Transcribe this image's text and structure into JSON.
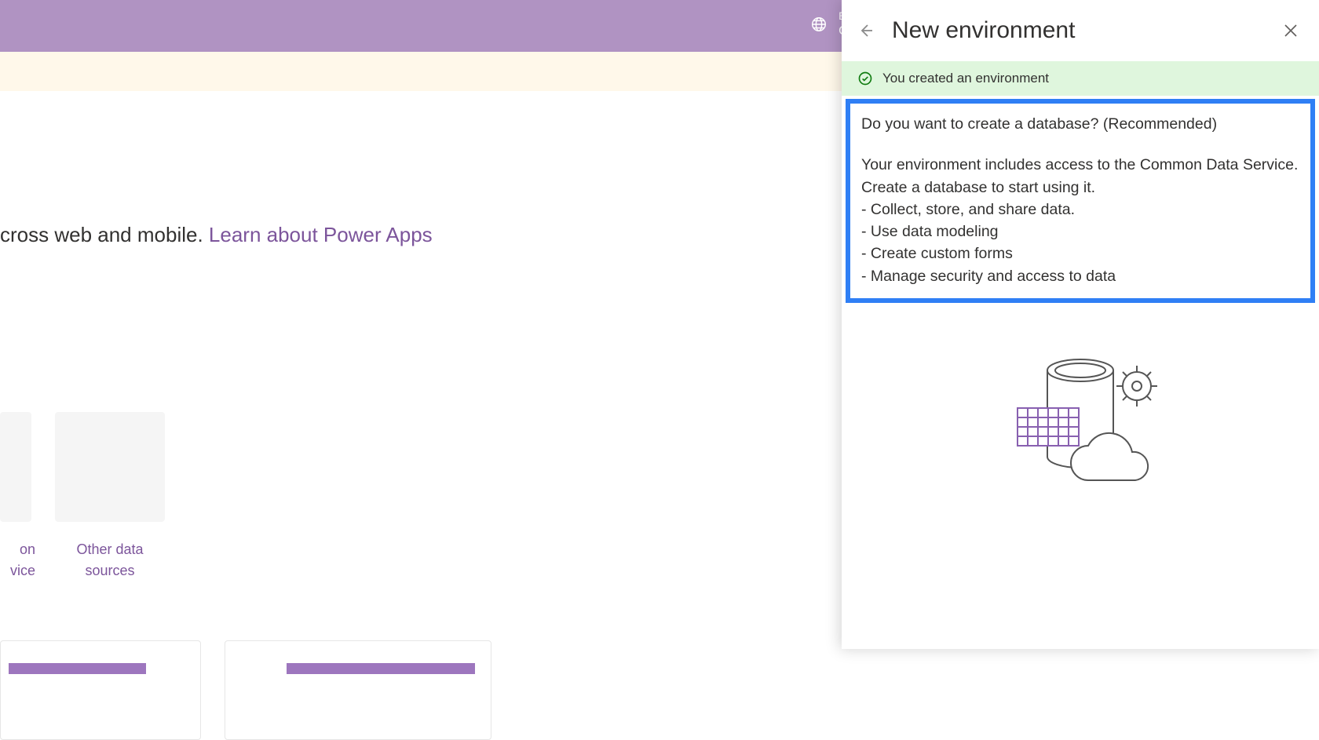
{
  "header": {
    "env_label": "Environ",
    "env_name": "CDSTu"
  },
  "main": {
    "hero_fragment": "cross web and mobile. ",
    "hero_link": "Learn about Power Apps",
    "tile_partial_line1": "on",
    "tile_partial_line2": "vice",
    "tile_other_line1": "Other data",
    "tile_other_line2": "sources"
  },
  "panel": {
    "title": "New environment",
    "success_msg": "You created an environment",
    "prompt_question": "Do you want to create a database? (Recommended)",
    "prompt_description": "Your environment includes access to the Common Data Service. Create a database to start using it.",
    "bullets": [
      "- Collect, store, and share data.",
      "- Use data modeling",
      "- Create custom forms",
      "- Manage security and access to data"
    ]
  }
}
